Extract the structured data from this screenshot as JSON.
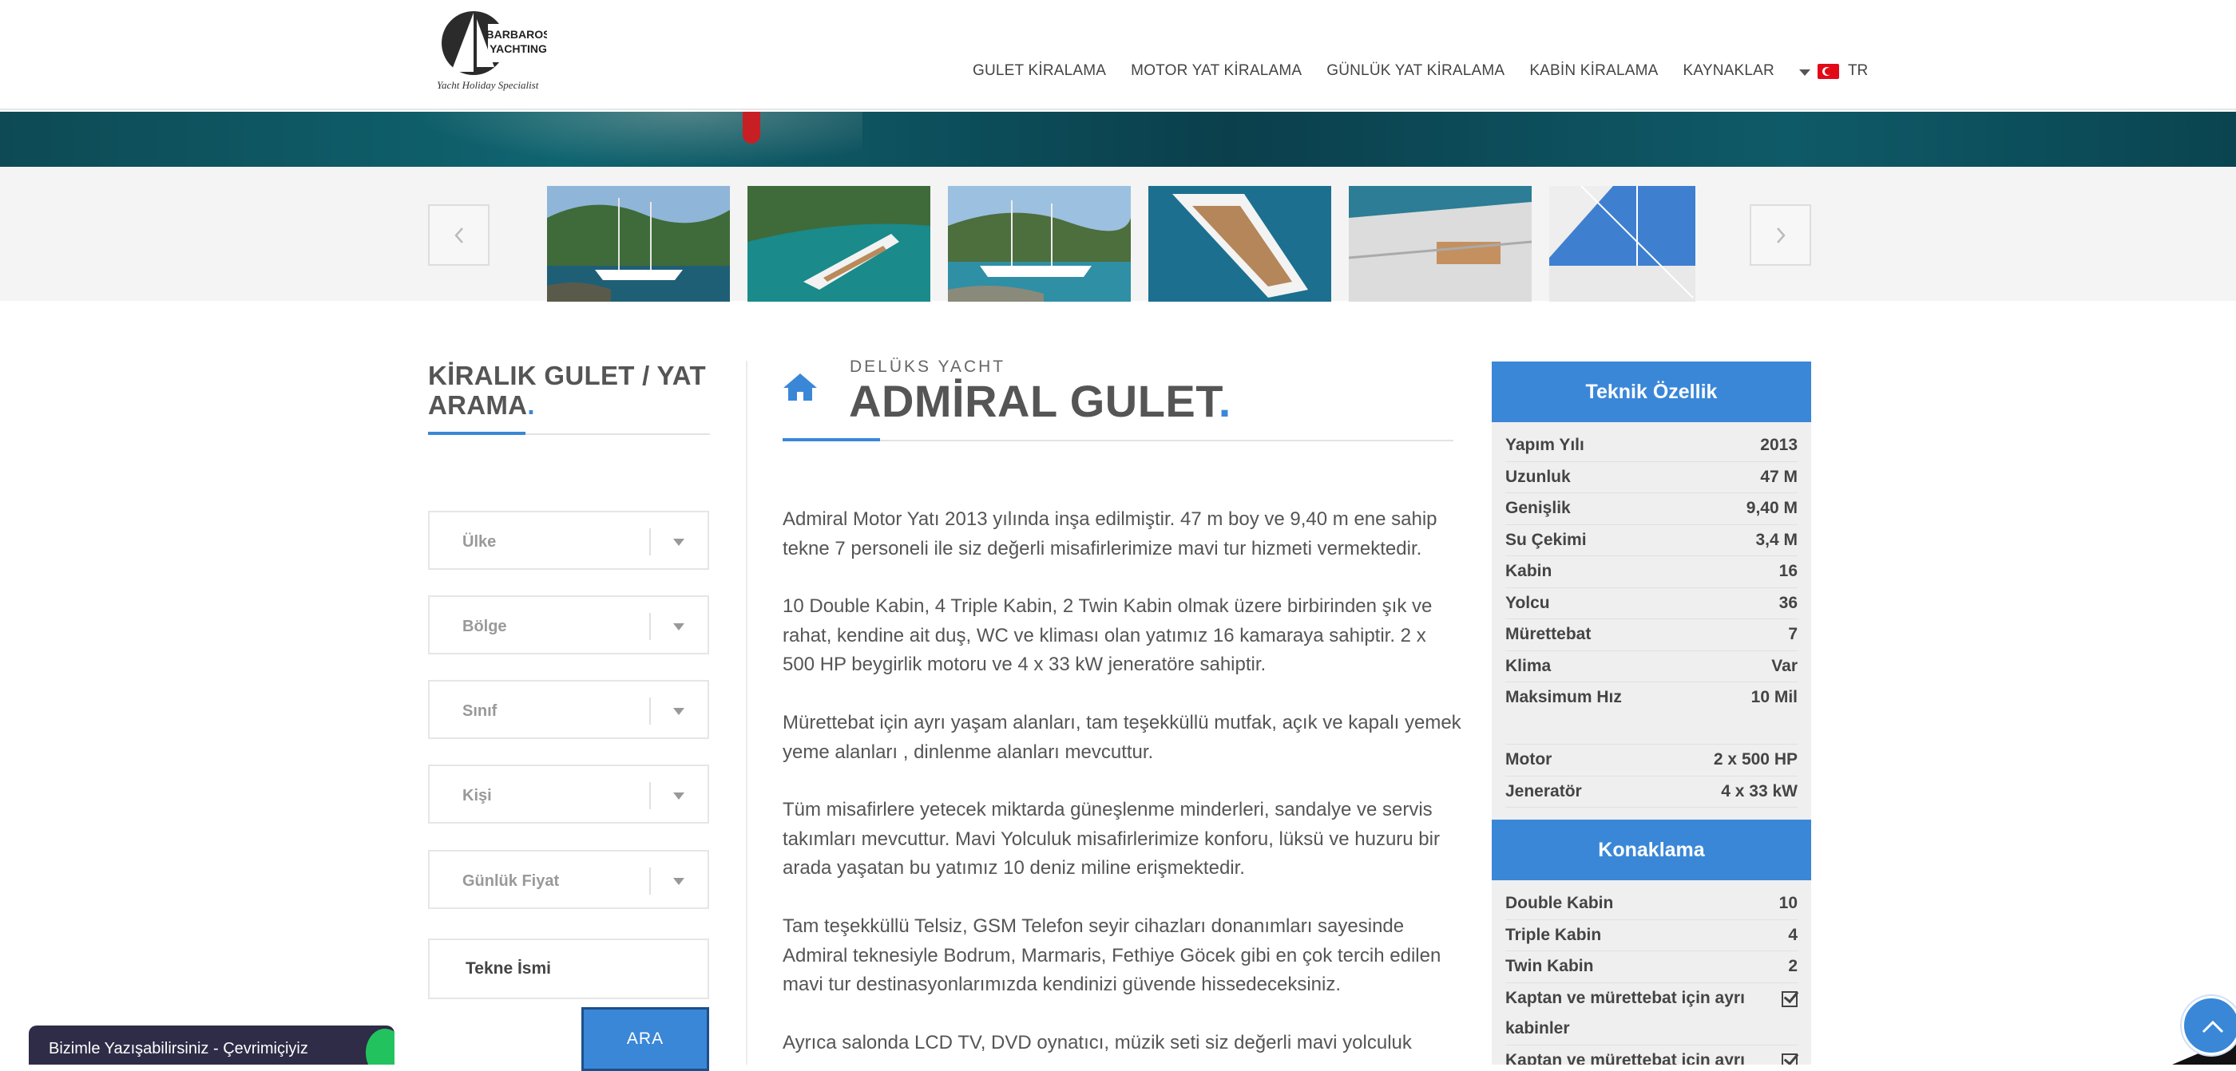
{
  "header": {
    "logo_text_1": "BARBAROS",
    "logo_text_2": "YACHTING",
    "logo_tagline": "Yacht Holiday Specialist",
    "nav": [
      "GULET KİRALAMA",
      "MOTOR YAT KİRALAMA",
      "GÜNLÜK YAT KİRALAMA",
      "KABİN KİRALAMA",
      "KAYNAKLAR"
    ],
    "lang": "TR"
  },
  "search": {
    "title": "KİRALIK GULET / YAT ARAMA",
    "selects": [
      "Ülke",
      "Bölge",
      "Sınıf",
      "Kişi",
      "Günlük Fiyat"
    ],
    "name_placeholder": "Tekne İsmi",
    "button": "ARA"
  },
  "yacht": {
    "kicker": "DELÜKS YACHT",
    "title": "ADMİRAL GULET",
    "paragraphs": [
      "Admiral Motor Yatı  2013 yılında inşa edilmiştir. 47 m boy ve 9,40 m ene sahip tekne 7 personeli ile siz değerli misafirlerimize mavi tur hizmeti vermektedir.",
      "10 Double Kabin, 4 Triple Kabin, 2 Twin Kabin olmak üzere birbirinden şık ve rahat, kendine ait duş, WC ve kliması olan yatımız 16 kamaraya sahiptir. 2 x 500 HP beygirlik motoru ve 4 x 33 kW jeneratöre sahiptir.",
      "Mürettebat için ayrı yaşam alanları, tam teşekküllü mutfak, açık ve kapalı yemek yeme alanları , dinlenme alanları mevcuttur.",
      "Tüm misafirlere yetecek miktarda güneşlenme minderleri, sandalye ve servis takımları mevcuttur. Mavi Yolculuk misafirlerimize konforu, lüksü ve huzuru bir arada yaşatan bu yatımız 10 deniz miline erişmektedir.",
      "Tam teşekküllü Telsiz, GSM Telefon seyir cihazları donanımları sayesinde Admiral teknesiyle Bodrum, Marmaris, Fethiye Göcek gibi en çok tercih edilen mavi tur destinasyonlarımızda kendinizi güvende hissedeceksiniz.",
      "Ayrıca salonda LCD TV, DVD oynatıcı, müzik seti siz değerli mavi yolculuk"
    ]
  },
  "specs": {
    "tech_title": "Teknik Özellik",
    "tech_rows": [
      {
        "k": "Yapım Yılı",
        "v": "2013"
      },
      {
        "k": "Uzunluk",
        "v": "47 M"
      },
      {
        "k": "Genişlik",
        "v": "9,40 M"
      },
      {
        "k": "Su Çekimi",
        "v": "3,4 M"
      },
      {
        "k": "Kabin",
        "v": "16"
      },
      {
        "k": "Yolcu",
        "v": "36"
      },
      {
        "k": "Mürettebat",
        "v": "7"
      },
      {
        "k": "Klima",
        "v": "Var"
      },
      {
        "k": "Maksimum Hız",
        "v": "10 Mil"
      },
      {
        "k": "Motor",
        "v": "2 x 500 HP"
      },
      {
        "k": "Jeneratör",
        "v": "4 x 33 kW"
      }
    ],
    "acc_title": "Konaklama",
    "acc_rows": [
      {
        "k": "Double Kabin",
        "v": "10"
      },
      {
        "k": "Triple Kabin",
        "v": "4"
      },
      {
        "k": "Twin Kabin",
        "v": "2"
      },
      {
        "k": "Kaptan ve mürettebat için ayrı kabinler",
        "v": ""
      },
      {
        "k": "Kaptan ve mürettebat için ayrı",
        "v": ""
      }
    ]
  },
  "chat": {
    "label": "Bizimle Yazışabilirsiniz - Çevrimiçiyiz"
  },
  "colors": {
    "accent": "#3a87d8",
    "chat_bg": "#2e2c46",
    "online": "#22c35e"
  }
}
